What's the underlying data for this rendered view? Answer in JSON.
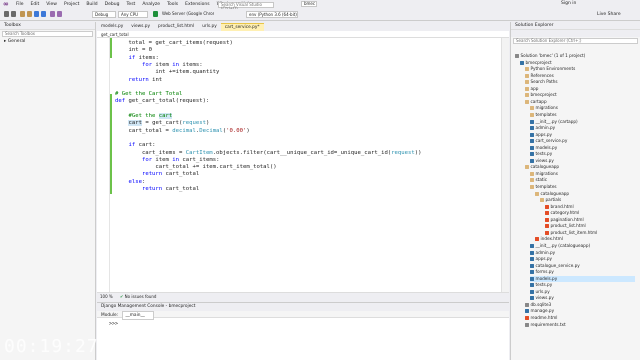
{
  "menu": [
    "File",
    "Edit",
    "View",
    "Project",
    "Build",
    "Debug",
    "Test",
    "Analyze",
    "Tools",
    "Extensions",
    "Window",
    "Help"
  ],
  "toolbar": {
    "search_placeholder": "Search Visual Studio (Ctrl+Q)",
    "solution_name": "bmec",
    "config": "Debug",
    "platform": "Any CPU",
    "run_target": "Web Server (Google Chrome)",
    "env": "env (Python 3.6 (64-bit))",
    "sign_in": "Sign in",
    "live_share": "Live Share"
  },
  "toolbox": {
    "title": "Toolbox",
    "search_placeholder": "Search Toolbox",
    "group": "▸ General"
  },
  "editor": {
    "tabs": [
      "models.py",
      "views.py",
      "product_list.html",
      "urls.py",
      "cart_service.py*"
    ],
    "active_tab": "cart_service.py*",
    "nav": "get_cart_total",
    "zoom": "100 %",
    "issues": "No issues found"
  },
  "code_lines": [
    [
      {
        "t": "    total = get_cart_items(request)"
      }
    ],
    [
      {
        "t": "    int = 0"
      }
    ],
    [
      {
        "t": "    ",
        "c": ""
      },
      {
        "t": "if",
        "c": "kw"
      },
      {
        "t": " items:"
      }
    ],
    [
      {
        "t": "        ",
        "c": ""
      },
      {
        "t": "for",
        "c": "kw"
      },
      {
        "t": " item ",
        "c": ""
      },
      {
        "t": "in",
        "c": "kw"
      },
      {
        "t": " items:"
      }
    ],
    [
      {
        "t": "            int +=item.quantity"
      }
    ],
    [
      {
        "t": "    ",
        "c": ""
      },
      {
        "t": "return",
        "c": "kw"
      },
      {
        "t": " int"
      }
    ],
    [
      {
        "t": ""
      }
    ],
    [
      {
        "t": "# Get the Cart Total",
        "c": "cm"
      }
    ],
    [
      {
        "t": "def",
        "c": "kw"
      },
      {
        "t": " get_cart_total(request):"
      }
    ],
    [
      {
        "t": ""
      }
    ],
    [
      {
        "t": "    #Get the ",
        "c": "cm"
      },
      {
        "t": "cart",
        "c": "cm hl"
      }
    ],
    [
      {
        "t": "    "
      },
      {
        "t": "cart",
        "c": "hl"
      },
      {
        "t": " = get_cart("
      },
      {
        "t": "request",
        "c": "ty"
      },
      {
        "t": ")"
      }
    ],
    [
      {
        "t": "    cart_total = "
      },
      {
        "t": "decimal",
        "c": "ty"
      },
      {
        "t": "."
      },
      {
        "t": "Decimal",
        "c": "ty"
      },
      {
        "t": "("
      },
      {
        "t": "'0.00'",
        "c": "st"
      },
      {
        "t": ")"
      }
    ],
    [
      {
        "t": ""
      }
    ],
    [
      {
        "t": "    "
      },
      {
        "t": "if",
        "c": "kw"
      },
      {
        "t": " cart:"
      }
    ],
    [
      {
        "t": "        cart_items = "
      },
      {
        "t": "CartItem",
        "c": "ty"
      },
      {
        "t": ".objects.filter(cart__unique_cart_id=_unique_cart_id("
      },
      {
        "t": "request",
        "c": "ty"
      },
      {
        "t": "))"
      }
    ],
    [
      {
        "t": "        "
      },
      {
        "t": "for",
        "c": "kw"
      },
      {
        "t": " item "
      },
      {
        "t": "in",
        "c": "kw"
      },
      {
        "t": " cart_items:"
      }
    ],
    [
      {
        "t": "            cart_total += item.cart_item_total()"
      }
    ],
    [
      {
        "t": "        "
      },
      {
        "t": "return",
        "c": "kw"
      },
      {
        "t": " cart_total"
      }
    ],
    [
      {
        "t": "    "
      },
      {
        "t": "else",
        "c": "kw"
      },
      {
        "t": ":"
      }
    ],
    [
      {
        "t": "        "
      },
      {
        "t": "return",
        "c": "kw"
      },
      {
        "t": " cart_total"
      }
    ]
  ],
  "console": {
    "title": "Django Management Console - bmecproject",
    "module_label": "Module:",
    "module_value": "__main__",
    "prompt": ">>>"
  },
  "solution_explorer": {
    "title": "Solution Explorer",
    "search_placeholder": "Search Solution Explorer (Ctrl+;)",
    "items": [
      {
        "label": "Solution 'bmec' (1 of 1 project)",
        "icon": "txt"
      },
      {
        "label": "bmecproject",
        "icon": "py"
      },
      {
        "label": "Python Environments",
        "icon": "folder"
      },
      {
        "label": "References",
        "icon": "folder"
      },
      {
        "label": "Search Paths",
        "icon": "folder"
      },
      {
        "label": "app",
        "icon": "folder"
      },
      {
        "label": "bmecproject",
        "icon": "folder"
      },
      {
        "label": "cartapp",
        "icon": "folder"
      },
      {
        "label": "migrations",
        "icon": "folder"
      },
      {
        "label": "templates",
        "icon": "folder"
      },
      {
        "label": "__init__.py (cartapp)",
        "icon": "py"
      },
      {
        "label": "admin.py",
        "icon": "py"
      },
      {
        "label": "apps.py",
        "icon": "py"
      },
      {
        "label": "cart_service.py",
        "icon": "py"
      },
      {
        "label": "models.py",
        "icon": "py"
      },
      {
        "label": "tests.py",
        "icon": "py"
      },
      {
        "label": "views.py",
        "icon": "py"
      },
      {
        "label": "catalogueapp",
        "icon": "folder"
      },
      {
        "label": "migrations",
        "icon": "folder"
      },
      {
        "label": "static",
        "icon": "folder"
      },
      {
        "label": "templates",
        "icon": "folder"
      },
      {
        "label": "catalogueapp",
        "icon": "folder"
      },
      {
        "label": "partials",
        "icon": "folder"
      },
      {
        "label": "brand.html",
        "icon": "html"
      },
      {
        "label": "category.html",
        "icon": "html"
      },
      {
        "label": "pagination.html",
        "icon": "html"
      },
      {
        "label": "product_list.html",
        "icon": "html"
      },
      {
        "label": "product_list_item.html",
        "icon": "html"
      },
      {
        "label": "index.html",
        "icon": "html"
      },
      {
        "label": "__init__.py (catalogueapp)",
        "icon": "py"
      },
      {
        "label": "admin.py",
        "icon": "py"
      },
      {
        "label": "apps.py",
        "icon": "py"
      },
      {
        "label": "catalogue_service.py",
        "icon": "py"
      },
      {
        "label": "forms.py",
        "icon": "py"
      },
      {
        "label": "models.py",
        "icon": "py"
      },
      {
        "label": "tests.py",
        "icon": "py"
      },
      {
        "label": "urls.py",
        "icon": "py"
      },
      {
        "label": "views.py",
        "icon": "py"
      },
      {
        "label": "db.sqlite3",
        "icon": "txt"
      },
      {
        "label": "manage.py",
        "icon": "py"
      },
      {
        "label": "readme.html",
        "icon": "html"
      },
      {
        "label": "requirements.txt",
        "icon": "txt"
      }
    ],
    "selected_index": 34
  },
  "overlay": {
    "timer": "00:19:27"
  },
  "colors": {
    "keyword": "#0000ff",
    "comment": "#008000",
    "type": "#2b91af",
    "string": "#a31515",
    "active_tab": "#fff0b3",
    "selection": "#cce8ff"
  }
}
